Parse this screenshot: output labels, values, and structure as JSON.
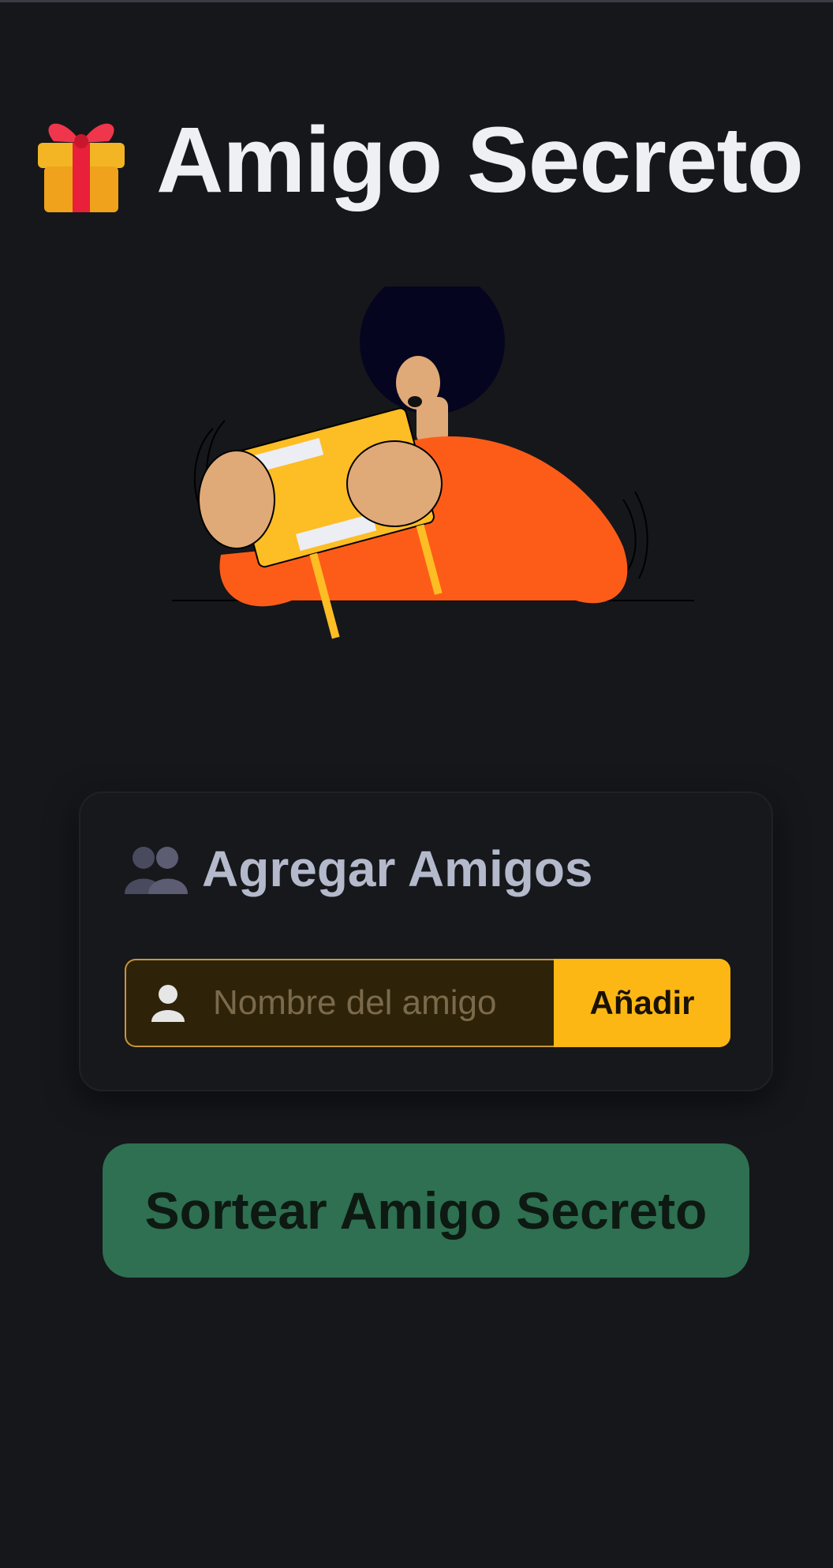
{
  "header": {
    "icon": "gift-icon",
    "title": "Amigo Secreto"
  },
  "illustration": {
    "icon": "person-holding-gift-illustration"
  },
  "add_friends": {
    "icon": "people-icon",
    "title": "Agregar Amigos",
    "input": {
      "icon": "user-icon",
      "placeholder": "Nombre del amigo",
      "value": ""
    },
    "add_button_label": "Añadir"
  },
  "draw_button_label": "Sortear Amigo Secreto",
  "colors": {
    "background": "#15171b",
    "accent_yellow": "#fdb714",
    "draw_green": "#2e7051",
    "title_text": "#eef0f4"
  }
}
